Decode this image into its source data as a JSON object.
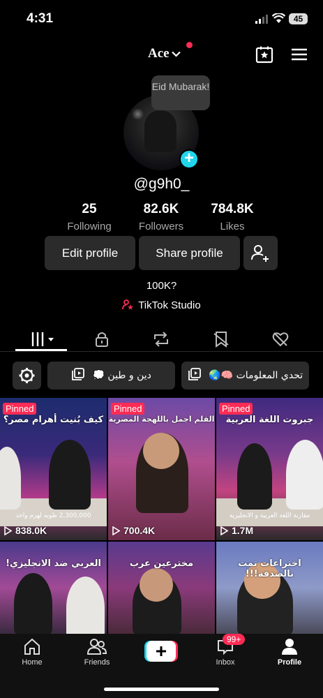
{
  "status_bar": {
    "time": "4:31",
    "battery": "45"
  },
  "header": {
    "account_name": "Ace",
    "icons": [
      "favorites-icon",
      "menu-icon"
    ]
  },
  "profile": {
    "bubble_text": "Eid Mubarak!",
    "handle": "@g9h0_",
    "stats": [
      {
        "value": "25",
        "label": "Following"
      },
      {
        "value": "82.6K",
        "label": "Followers"
      },
      {
        "value": "784.8K",
        "label": "Likes"
      }
    ],
    "edit_label": "Edit profile",
    "share_label": "Share profile",
    "bio": "100K?",
    "studio_label": "TikTok Studio"
  },
  "tabs": [
    "videos-tab",
    "private-tab",
    "reposts-tab",
    "favorites-tab",
    "liked-tab"
  ],
  "playlists": [
    {
      "label": "تحدي المعلومات 🧠🌏"
    },
    {
      "label": "دين و طين 💭"
    }
  ],
  "videos": [
    {
      "title": "كيف بُنيت أهرام مصر؟",
      "subtitle": "2,300,000 طوبه لهرم واحد",
      "views": "838.0K",
      "pinned": true,
      "pinned_label": "Pinned"
    },
    {
      "title": "الفلم اجمل باللهجة المصرية",
      "subtitle": "",
      "views": "700.4K",
      "pinned": true,
      "pinned_label": "Pinned"
    },
    {
      "title": "جبروت اللغة العربية",
      "subtitle": "مقارنة اللغة العربية و الانجليزية",
      "views": "1.7M",
      "pinned": true,
      "pinned_label": "Pinned"
    },
    {
      "title": "العربي ضد الانجليزي!",
      "subtitle": "",
      "views": "",
      "pinned": false
    },
    {
      "title": "مخترعين عرب",
      "subtitle": "",
      "views": "",
      "pinned": false
    },
    {
      "title": "اختراعات تمت بالصدفة!!!",
      "subtitle": "",
      "views": "",
      "pinned": false
    }
  ],
  "nav": {
    "home": "Home",
    "friends": "Friends",
    "inbox": "Inbox",
    "inbox_badge": "99+",
    "profile": "Profile"
  },
  "colors": {
    "accent": "#fe2c55",
    "cyan": "#20d5ec",
    "button_bg": "#2b2b2b"
  }
}
